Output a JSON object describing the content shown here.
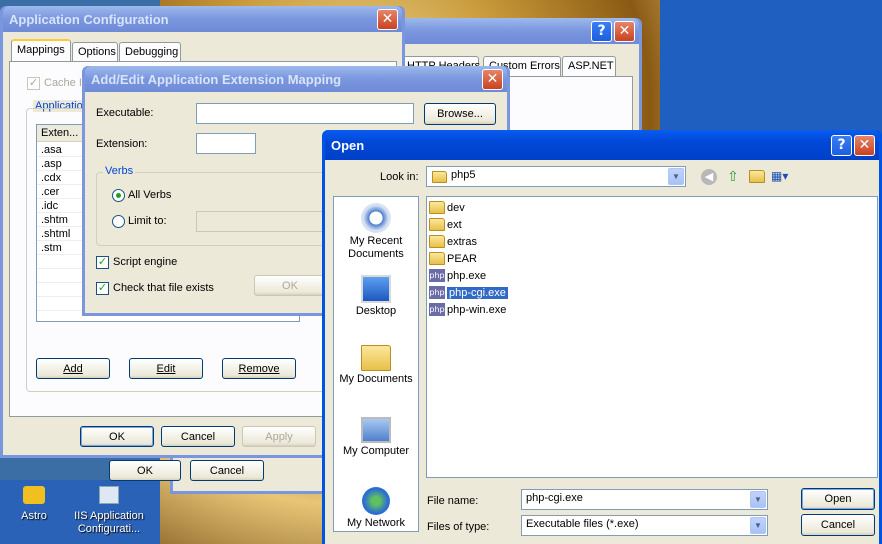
{
  "desktop": {
    "icons": [
      {
        "label": "Astro"
      },
      {
        "label": "IIS Application\nConfigurati..."
      }
    ]
  },
  "app_config": {
    "title": "Application Configuration",
    "tabs": [
      "Mappings",
      "Options",
      "Debugging"
    ],
    "cache_label": "Cache IS",
    "group_label": "Applicatio",
    "list_header": "Exten...",
    "extensions": [
      ".asa",
      ".asp",
      ".cdx",
      ".cer",
      ".idc",
      ".shtm",
      ".shtml",
      ".stm"
    ],
    "buttons": {
      "add": "Add",
      "edit": "Edit",
      "remove": "Remove",
      "ok": "OK",
      "cancel": "Cancel",
      "apply": "Apply"
    }
  },
  "back_props": {
    "tabs": [
      "HTTP Headers",
      "Custom Errors",
      "ASP.NET"
    ],
    "buttons": {
      "ok": "OK",
      "cancel": "Cancel"
    }
  },
  "add_edit": {
    "title": "Add/Edit Application Extension Mapping",
    "executable_label": "Executable:",
    "executable_value": "",
    "browse": "Browse...",
    "extension_label": "Extension:",
    "extension_value": "",
    "verbs_label": "Verbs",
    "all_verbs": "All Verbs",
    "limit_to": "Limit to:",
    "script_engine": "Script engine",
    "check_file": "Check that file exists",
    "ok": "OK"
  },
  "open_dialog": {
    "title": "Open",
    "look_in_label": "Look in:",
    "look_in_value": "php5",
    "places": [
      "My Recent\nDocuments",
      "Desktop",
      "My Documents",
      "My Computer",
      "My Network"
    ],
    "files": [
      {
        "name": "dev",
        "type": "folder"
      },
      {
        "name": "ext",
        "type": "folder"
      },
      {
        "name": "extras",
        "type": "folder"
      },
      {
        "name": "PEAR",
        "type": "folder"
      },
      {
        "name": "php.exe",
        "type": "php"
      },
      {
        "name": "php-cgi.exe",
        "type": "php",
        "selected": true
      },
      {
        "name": "php-win.exe",
        "type": "php"
      }
    ],
    "php_icon_text": "php",
    "file_name_label": "File name:",
    "file_name_value": "php-cgi.exe",
    "file_type_label": "Files of type:",
    "file_type_value": "Executable files (*.exe)",
    "open_button": "Open",
    "cancel_button": "Cancel"
  },
  "colors": {
    "xp_blue_title": "#0054e3",
    "selection": "#316ac5",
    "dialog_face": "#ece9d8"
  }
}
